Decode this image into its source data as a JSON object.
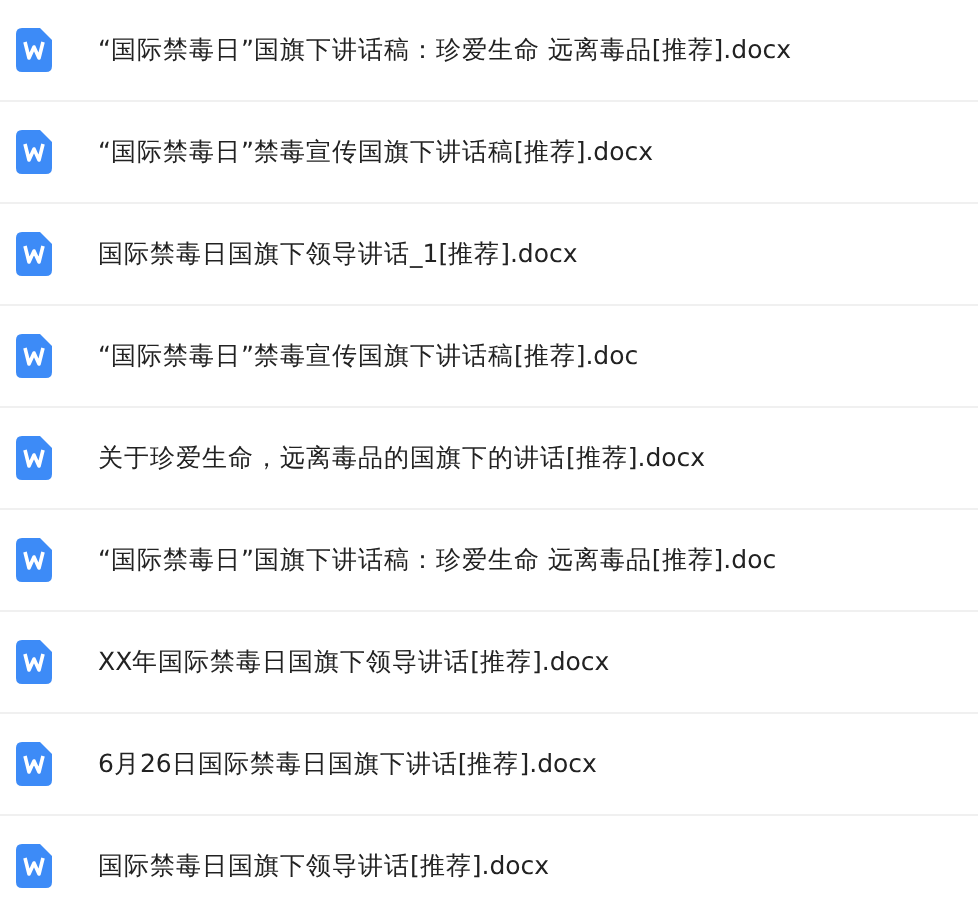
{
  "files": [
    {
      "name": "“国际禁毒日”国旗下讲话稿：珍爱生命 远离毒品[推荐].docx"
    },
    {
      "name": "“国际禁毒日”禁毒宣传国旗下讲话稿[推荐].docx"
    },
    {
      "name": "国际禁毒日国旗下领导讲话_1[推荐].docx"
    },
    {
      "name": "“国际禁毒日”禁毒宣传国旗下讲话稿[推荐].doc"
    },
    {
      "name": "关于珍爱生命，远离毒品的国旗下的讲话[推荐].docx"
    },
    {
      "name": "“国际禁毒日”国旗下讲话稿：珍爱生命 远离毒品[推荐].doc"
    },
    {
      "name": "XX年国际禁毒日国旗下领导讲话[推荐].docx"
    },
    {
      "name": "6月26日国际禁毒日国旗下讲话[推荐].docx"
    },
    {
      "name": "国际禁毒日国旗下领导讲话[推荐].docx"
    }
  ]
}
